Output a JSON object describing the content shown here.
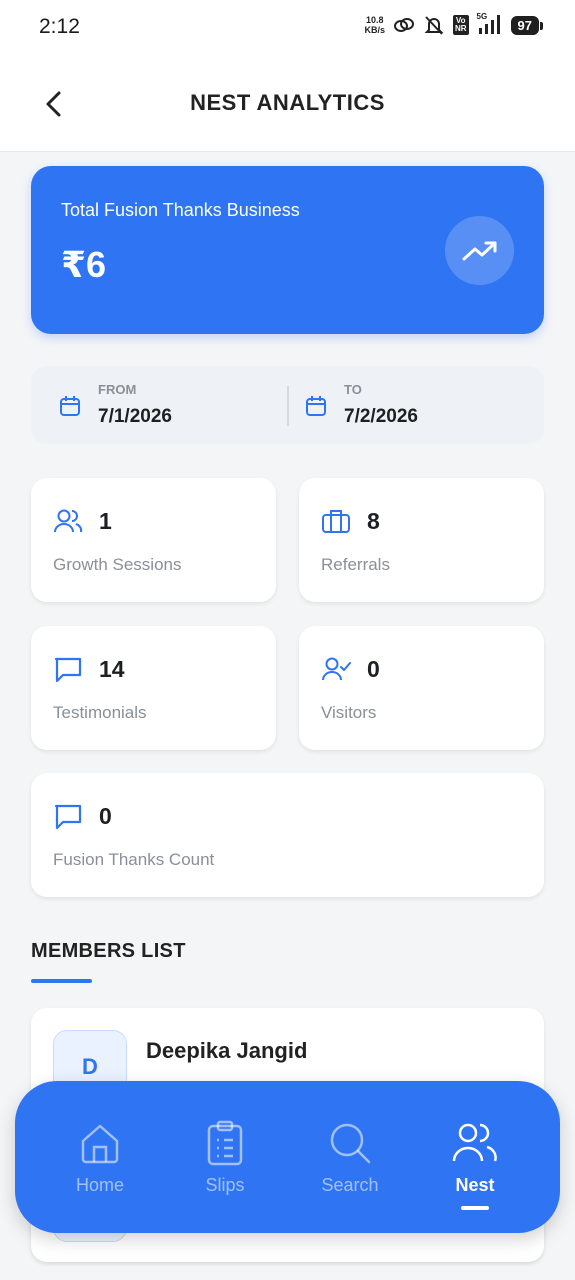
{
  "status_bar": {
    "time": "2:12",
    "net_speed_value": "10.8",
    "net_speed_unit": "KB/s",
    "volte_top": "Vo",
    "volte_bottom": "NR",
    "network": "5G",
    "battery": "97"
  },
  "header": {
    "title": "NEST ANALYTICS",
    "back_icon": "chevron-left-icon"
  },
  "hero": {
    "label": "Total Fusion Thanks Business",
    "value": "₹6",
    "icon": "trending-up-icon",
    "color": "#2f74f3"
  },
  "date_range": {
    "from_label": "FROM",
    "from_value": "7/1/2026",
    "to_label": "TO",
    "to_value": "7/2/2026"
  },
  "stats": {
    "growth_sessions": {
      "value": "1",
      "label": "Growth Sessions",
      "icon": "users-icon"
    },
    "referrals": {
      "value": "8",
      "label": "Referrals",
      "icon": "briefcase-icon"
    },
    "testimonials": {
      "value": "14",
      "label": "Testimonials",
      "icon": "message-icon"
    },
    "visitors": {
      "value": "0",
      "label": "Visitors",
      "icon": "user-check-icon"
    },
    "fusion_thanks_count": {
      "value": "0",
      "label": "Fusion Thanks Count",
      "icon": "message-icon"
    }
  },
  "members": {
    "section_title": "MEMBERS LIST",
    "items": [
      {
        "initial": "D",
        "name": "Deepika Jangid"
      }
    ]
  },
  "nav": {
    "items": [
      {
        "label": "Home",
        "icon": "home-icon"
      },
      {
        "label": "Slips",
        "icon": "clipboard-icon"
      },
      {
        "label": "Search",
        "icon": "search-icon"
      },
      {
        "label": "Nest",
        "icon": "users-icon"
      }
    ],
    "active": "Nest"
  },
  "colors": {
    "accent": "#2f74f3",
    "background": "#f4f5f7",
    "muted_text": "#8a8f98"
  }
}
